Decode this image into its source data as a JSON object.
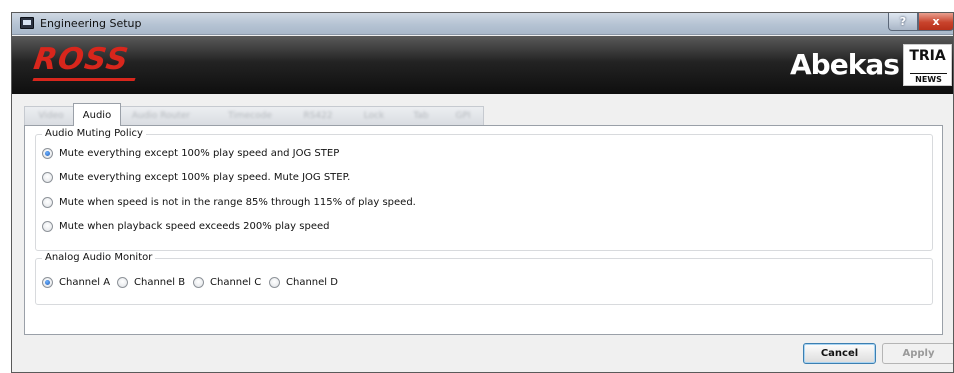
{
  "window": {
    "title": "Engineering Setup",
    "help_label": "?",
    "close_label": "x"
  },
  "banner": {
    "left_logo": "ROSS",
    "right_logo": "Abekas",
    "badge_top": "TRIA",
    "badge_bottom": "NEWS"
  },
  "tabs": [
    {
      "label": "Video",
      "active": false
    },
    {
      "label": "Audio",
      "active": true
    },
    {
      "label": "Audio Router",
      "active": false
    },
    {
      "label": "Timecode",
      "active": false
    },
    {
      "label": "RS422",
      "active": false
    },
    {
      "label": "Lock",
      "active": false
    },
    {
      "label": "Tab",
      "active": false
    },
    {
      "label": "GPI",
      "active": false
    }
  ],
  "audio_muting": {
    "title": "Audio Muting Policy",
    "options": [
      {
        "label": "Mute everything except 100% play speed and JOG STEP",
        "checked": true
      },
      {
        "label": "Mute everything except 100% play speed. Mute JOG STEP.",
        "checked": false
      },
      {
        "label": "Mute when speed is not in the range 85% through 115% of play speed.",
        "checked": false
      },
      {
        "label": "Mute when playback speed exceeds 200% play speed",
        "checked": false
      }
    ]
  },
  "analog_monitor": {
    "title": "Analog Audio Monitor",
    "options": [
      {
        "label": "Channel A",
        "checked": true
      },
      {
        "label": "Channel B",
        "checked": false
      },
      {
        "label": "Channel C",
        "checked": false
      },
      {
        "label": "Channel D",
        "checked": false
      }
    ]
  },
  "actions": {
    "cancel_label": "Cancel",
    "apply_label": "Apply",
    "apply_enabled": false
  },
  "colors": {
    "ross_red": "#d8261c",
    "banner_dark": "#0e0e0e",
    "radio_selected": "#1f5cb8"
  }
}
